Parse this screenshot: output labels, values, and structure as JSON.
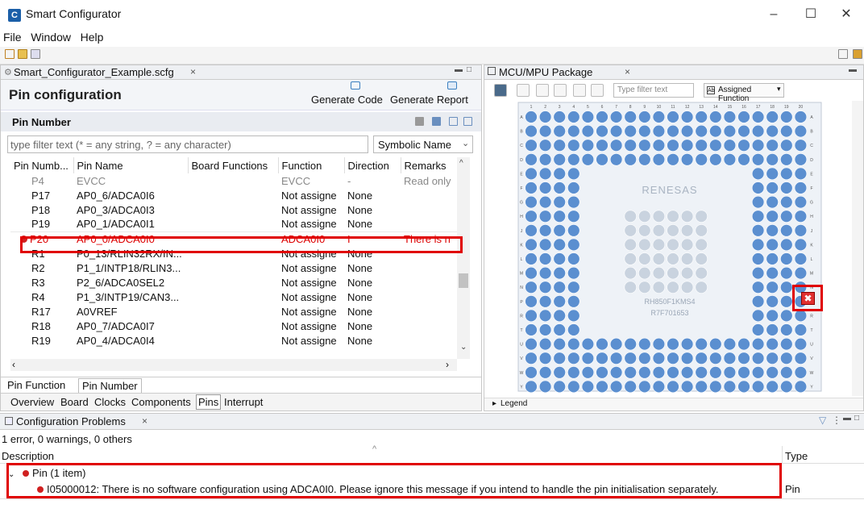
{
  "window": {
    "title": "Smart Configurator",
    "app_icon_letter": "C"
  },
  "menu": [
    "File",
    "Window",
    "Help"
  ],
  "editor": {
    "tab_label": "Smart_Configurator_Example.scfg",
    "heading": "Pin configuration",
    "generate_code": "Generate Code",
    "generate_report": "Generate Report",
    "section_title": "Pin Number",
    "filter_placeholder": "type filter text (* = any string, ? = any character)",
    "symbolic_name": "Symbolic Name",
    "columns": [
      "Pin Numb...",
      "Pin Name",
      "Board Functions",
      "Function",
      "Direction",
      "Remarks"
    ],
    "rows": [
      {
        "pin": "P4",
        "name": "EVCC",
        "board": "",
        "function": "EVCC",
        "direction": "-",
        "remarks": "Read only",
        "style": "dim"
      },
      {
        "pin": "P17",
        "name": "AP0_6/ADCA0I6",
        "board": "",
        "function": "Not assigne",
        "direction": "None",
        "remarks": "",
        "style": ""
      },
      {
        "pin": "P18",
        "name": "AP0_3/ADCA0I3",
        "board": "",
        "function": "Not assigne",
        "direction": "None",
        "remarks": "",
        "style": ""
      },
      {
        "pin": "P19",
        "name": "AP0_1/ADCA0I1",
        "board": "",
        "function": "Not assigne",
        "direction": "None",
        "remarks": "",
        "style": ""
      },
      {
        "pin": "P20",
        "name": "AP0_0/ADCA0I0",
        "board": "",
        "function": "ADCA0I0",
        "direction": "I",
        "remarks": "There is n",
        "style": "err"
      },
      {
        "pin": "R1",
        "name": "P0_13/RLIN32RX/IN...",
        "board": "",
        "function": "Not assigne",
        "direction": "None",
        "remarks": "",
        "style": ""
      },
      {
        "pin": "R2",
        "name": "P1_1/INTP18/RLIN3...",
        "board": "",
        "function": "Not assigne",
        "direction": "None",
        "remarks": "",
        "style": ""
      },
      {
        "pin": "R3",
        "name": "P2_6/ADCA0SEL2",
        "board": "",
        "function": "Not assigne",
        "direction": "None",
        "remarks": "",
        "style": ""
      },
      {
        "pin": "R4",
        "name": "P1_3/INTP19/CAN3...",
        "board": "",
        "function": "Not assigne",
        "direction": "None",
        "remarks": "",
        "style": ""
      },
      {
        "pin": "R17",
        "name": "A0VREF",
        "board": "",
        "function": "Not assigne",
        "direction": "None",
        "remarks": "",
        "style": ""
      },
      {
        "pin": "R18",
        "name": "AP0_7/ADCA0I7",
        "board": "",
        "function": "Not assigne",
        "direction": "None",
        "remarks": "",
        "style": ""
      },
      {
        "pin": "R19",
        "name": "AP0_4/ADCA0I4",
        "board": "",
        "function": "Not assigne",
        "direction": "None",
        "remarks": "",
        "style": ""
      }
    ],
    "subtabs": [
      "Pin Function",
      "Pin Number"
    ],
    "bottom_tabs": [
      "Overview",
      "Board",
      "Clocks",
      "Components",
      "Pins",
      "Interrupt"
    ]
  },
  "package": {
    "tab_label": "MCU/MPU Package",
    "filter_placeholder": "Type filter text",
    "assigned_function": "Assigned Function",
    "brand": "RENESAS",
    "chip_line1": "RH850F1KMS4",
    "chip_line2": "R7F701653",
    "legend": "Legend",
    "col_labels": [
      "1",
      "2",
      "3",
      "4",
      "5",
      "6",
      "7",
      "8",
      "9",
      "10",
      "11",
      "12",
      "13",
      "14",
      "15",
      "16",
      "17",
      "18",
      "19",
      "20"
    ],
    "row_labels": [
      "A",
      "B",
      "C",
      "D",
      "E",
      "F",
      "G",
      "H",
      "J",
      "K",
      "L",
      "M",
      "N",
      "P",
      "R",
      "T",
      "U",
      "V",
      "W",
      "Y"
    ]
  },
  "problems": {
    "tab_label": "Configuration Problems",
    "summary": "1 error, 0 warnings, 0 others",
    "col_description": "Description",
    "col_type": "Type",
    "group_label": "Pin (1 item)",
    "error_text": "I05000012: There is no software configuration using ADCA0I0. Please ignore this message if you intend to handle the pin initialisation separately.",
    "error_type": "Pin"
  },
  "colors": {
    "accent_red": "#e00000",
    "pin_blue": "#5b8fd0",
    "pin_grey": "#c9d3df",
    "tab_bg": "#eef0f3"
  }
}
